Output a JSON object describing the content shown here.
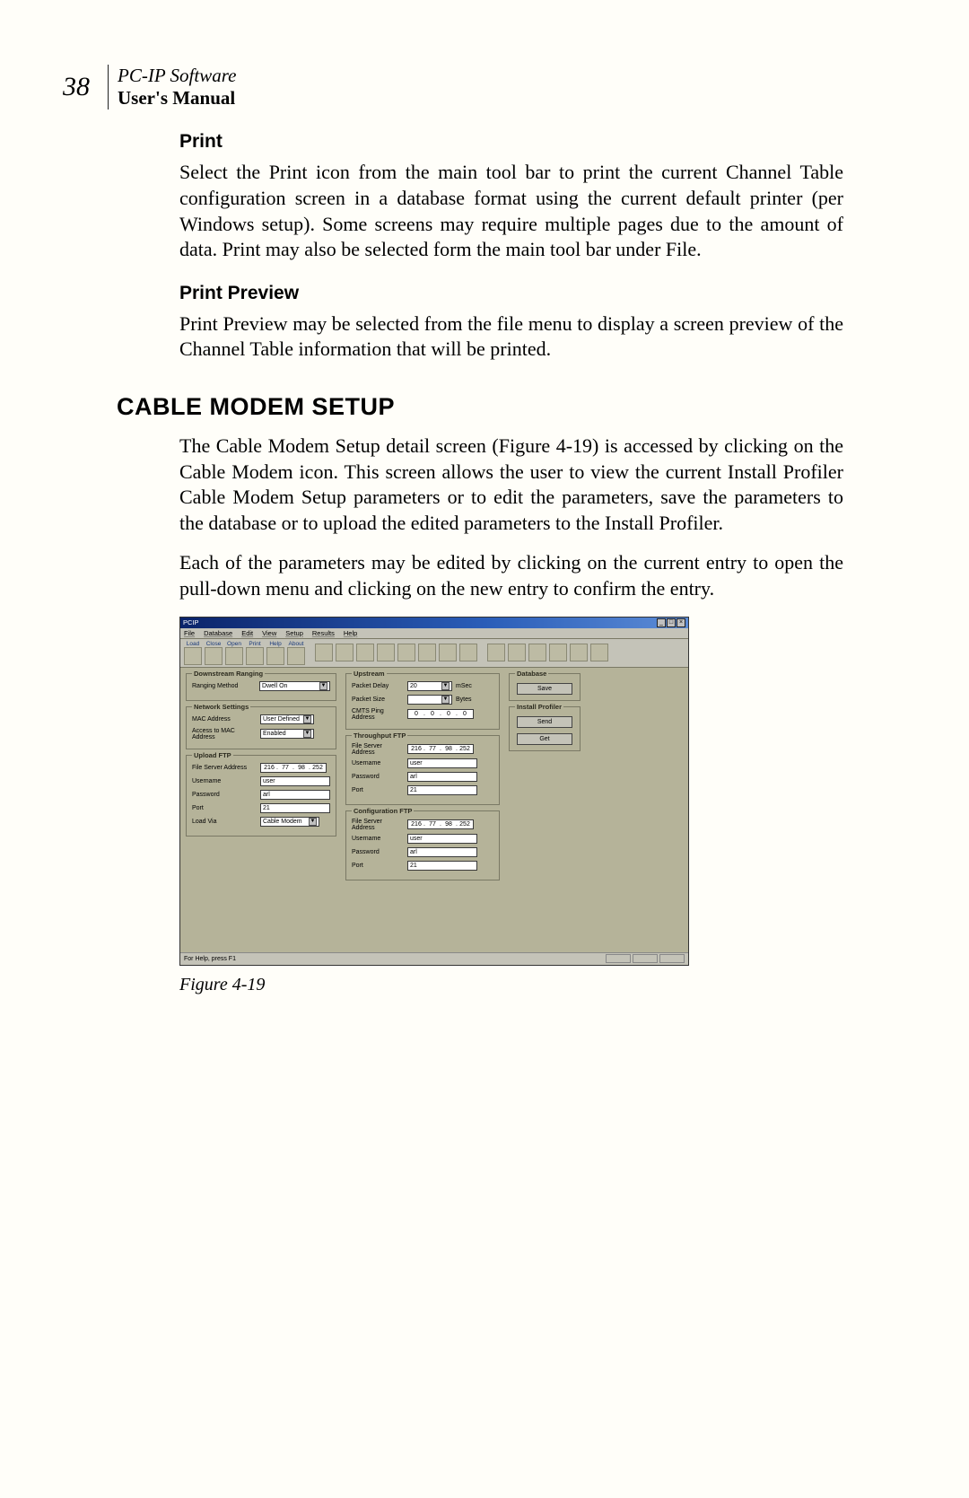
{
  "header": {
    "page_number": "38",
    "software_name": "PC-IP Software",
    "manual_label": "User's Manual"
  },
  "section_print": {
    "heading": "Print",
    "para": "Select the Print icon from the main tool bar to print the current Channel Table configuration screen in a database format using the current default printer (per Windows setup). Some screens may require multiple pages due to the amount of data. Print may also be selected form the main tool bar under File."
  },
  "section_preview": {
    "heading": "Print Preview",
    "para": "Print Preview may be selected from the file menu to display a screen preview of the Channel Table information that will be printed."
  },
  "main_heading": "CABLE MODEM SETUP",
  "cms_para1": "The Cable Modem Setup detail screen (Figure 4-19) is accessed by clicking on the Cable Modem icon. This screen allows the user to view the current Install Profiler Cable Modem Setup parameters or to edit the parameters, save the parameters to the database or to upload the edited parameters to the Install Profiler.",
  "cms_para2": "Each of the parameters may be edited by clicking on the current entry to open the pull-down menu and clicking on the new entry to confirm the entry.",
  "caption": "Figure 4-19",
  "win": {
    "title": "PCIP",
    "menus": [
      "File",
      "Database",
      "Edit",
      "View",
      "Setup",
      "Results",
      "Help"
    ],
    "tool_labels": [
      "Load",
      "Close",
      "Open",
      "Print",
      "Help",
      "About"
    ],
    "status": "For Help, press F1"
  },
  "grp": {
    "downstream": {
      "title": "Downstream Ranging",
      "ranging_label": "Ranging Method",
      "ranging_value": "Dwell On"
    },
    "network": {
      "title": "Network Settings",
      "mac_label": "MAC Address",
      "mac_value": "User Defined",
      "access_label": "Access to MAC Address",
      "access_value": "Enabled"
    },
    "upload": {
      "title": "Upload FTP",
      "addr_label": "File Server Address",
      "ip": [
        "216",
        "77",
        "98",
        "252"
      ],
      "user_label": "Username",
      "user_value": "user",
      "pass_label": "Password",
      "pass_value": "arl",
      "port_label": "Port",
      "port_value": "21",
      "loadvia_label": "Load Via",
      "loadvia_value": "Cable Modem"
    },
    "upstream": {
      "title": "Upstream",
      "delay_label": "Packet Delay",
      "delay_value": "20",
      "delay_unit": "mSec",
      "size_label": "Packet Size",
      "size_value": "",
      "size_unit": "Bytes",
      "ping_label": "CMTS Ping Address",
      "ping_ip": [
        "0",
        "0",
        "0",
        "0"
      ]
    },
    "throughput": {
      "title": "Throughput FTP",
      "addr_label": "File Server Address",
      "ip": [
        "216",
        "77",
        "98",
        "252"
      ],
      "user_label": "Username",
      "user_value": "user",
      "pass_label": "Password",
      "pass_value": "arl",
      "port_label": "Port",
      "port_value": "21"
    },
    "config": {
      "title": "Configuration FTP",
      "addr_label": "File Server Address",
      "ip": [
        "216",
        "77",
        "98",
        "252"
      ],
      "user_label": "Username",
      "user_value": "user",
      "pass_label": "Password",
      "pass_value": "arl",
      "port_label": "Port",
      "port_value": "21"
    },
    "database": {
      "title": "Database",
      "save_btn": "Save"
    },
    "profiler": {
      "title": "Install Profiler",
      "send_btn": "Send",
      "get_btn": "Get"
    }
  }
}
